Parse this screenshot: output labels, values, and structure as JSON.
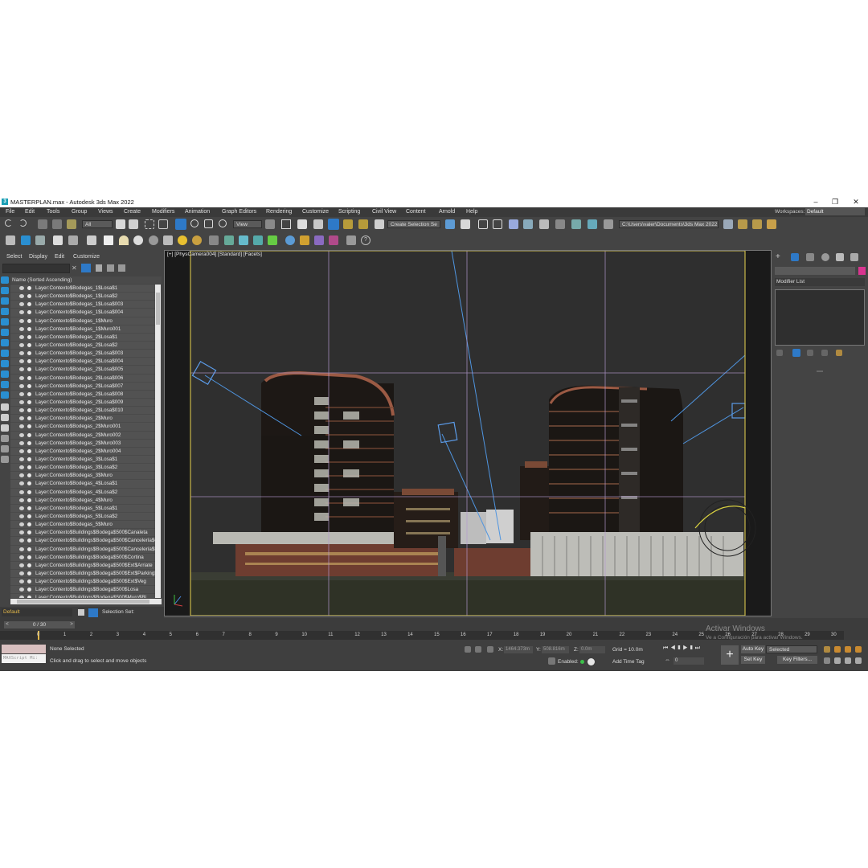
{
  "window": {
    "title": "MASTERPLAN.max - Autodesk 3ds Max 2022",
    "app_icon": "3"
  },
  "menu": [
    "File",
    "Edit",
    "Tools",
    "Group",
    "Views",
    "Create",
    "Modifiers",
    "Animation",
    "Graph Editors",
    "Rendering",
    "Customize",
    "Scripting",
    "Civil View",
    "Content",
    "Arnold",
    "Help"
  ],
  "workspaces": {
    "label": "Workspaces:",
    "value": "Default"
  },
  "toolbar": {
    "filter_value": "All",
    "ref_coord": "View",
    "named_selection_placeholder": "Create Selection Se",
    "project_path": "C:\\Users\\valer\\Documents\\3ds Max 2022"
  },
  "scene_explorer": {
    "tabs": [
      "Select",
      "Display",
      "Edit",
      "Customize"
    ],
    "header": "Name (Sorted Ascending)",
    "items": [
      "Layer:Contexto$Bodegas_1$Losa$1",
      "Layer:Contexto$Bodegas_1$Losa$2",
      "Layer:Contexto$Bodegas_1$Losa$003",
      "Layer:Contexto$Bodegas_1$Losa$004",
      "Layer:Contexto$Bodegas_1$Muro",
      "Layer:Contexto$Bodegas_1$Muro001",
      "Layer:Contexto$Bodegas_2$Losa$1",
      "Layer:Contexto$Bodegas_2$Losa$2",
      "Layer:Contexto$Bodegas_2$Losa$003",
      "Layer:Contexto$Bodegas_2$Losa$004",
      "Layer:Contexto$Bodegas_2$Losa$005",
      "Layer:Contexto$Bodegas_2$Losa$006",
      "Layer:Contexto$Bodegas_2$Losa$007",
      "Layer:Contexto$Bodegas_2$Losa$008",
      "Layer:Contexto$Bodegas_2$Losa$009",
      "Layer:Contexto$Bodegas_2$Losa$010",
      "Layer:Contexto$Bodegas_2$Muro",
      "Layer:Contexto$Bodegas_2$Muro001",
      "Layer:Contexto$Bodegas_2$Muro002",
      "Layer:Contexto$Bodegas_2$Muro003",
      "Layer:Contexto$Bodegas_2$Muro004",
      "Layer:Contexto$Bodegas_3$Losa$1",
      "Layer:Contexto$Bodegas_3$Losa$2",
      "Layer:Contexto$Bodegas_3$Muro",
      "Layer:Contexto$Bodegas_4$Losa$1",
      "Layer:Contexto$Bodegas_4$Losa$2",
      "Layer:Contexto$Bodegas_4$Muro",
      "Layer:Contexto$Bodegas_5$Losa$1",
      "Layer:Contexto$Bodegas_5$Losa$2",
      "Layer:Contexto$Bodegas_5$Muro",
      "Layer:Contexto$Buildings$Bodega$500$Canaleta",
      "Layer:Contexto$Buildings$Bodega$500$Cancelería$Gl",
      "Layer:Contexto$Buildings$Bodega$500$Cancelería$Pe",
      "Layer:Contexto$Buildings$Bodega$500$Cortina",
      "Layer:Contexto$Buildings$Bodega$500$Ext$Arriate",
      "Layer:Contexto$Buildings$Bodega$500$Ext$Parking$T",
      "Layer:Contexto$Buildings$Bodega$500$Ext$Veg",
      "Layer:Contexto$Buildings$Bodega$500$Losa",
      "Layer:Contexto$Buildings$Bodega$500$Muro$Bl"
    ]
  },
  "layer": {
    "current": "Default",
    "selection_set_label": "Selection Set:"
  },
  "viewport": {
    "label": "[+] [PhysCamera004] [Standard] [Facets]"
  },
  "command_panel": {
    "modifier_list": "Modifier List",
    "color": "#d9348f"
  },
  "timeline": {
    "frame_display": "0 / 30",
    "ticks": [
      "0",
      "1",
      "2",
      "3",
      "4",
      "5",
      "6",
      "7",
      "8",
      "9",
      "10",
      "11",
      "12",
      "13",
      "14",
      "15",
      "16",
      "17",
      "18",
      "19",
      "20",
      "21",
      "22",
      "23",
      "24",
      "25",
      "26",
      "27",
      "28",
      "29",
      "30"
    ]
  },
  "status": {
    "maxscript_placeholder": "MAXScript Mi:",
    "selection": "None Selected",
    "prompt": "Click and drag to select and move objects",
    "x_label": "X:",
    "x_value": "1464.373m",
    "y_label": "Y:",
    "y_value": "508.816m",
    "z_label": "Z:",
    "z_value": "0.0m",
    "grid": "Grid = 10.0m",
    "enabled_label": "Enabled:",
    "add_time_tag": "Add Time Tag",
    "auto_key": "Auto Key",
    "set_key": "Set Key",
    "key_mode": "Selected",
    "key_filters": "Key Filters...",
    "current_frame": "0",
    "watermark_title": "Activar Windows",
    "watermark_sub": "Ve a Configuración para activar Windows."
  },
  "icons": [
    "undo-icon",
    "redo-icon",
    "link-icon",
    "unlink-icon",
    "bind-spacewarp-icon",
    "select-object-icon",
    "select-by-name-icon",
    "rect-region-icon",
    "window-crossing-icon",
    "move-icon",
    "rotate-icon",
    "scale-icon",
    "placement-icon",
    "pivot-icon",
    "mirror-icon",
    "align-icon",
    "snap-icon",
    "angle-snap-icon",
    "percent-snap-icon",
    "spinner-snap-icon",
    "layer-explorer-icon",
    "ribbon-icon",
    "curve-editor-icon",
    "schematic-icon",
    "material-editor-icon",
    "render-setup-icon",
    "render-frame-icon",
    "render-icon",
    "play-icon",
    "key-icon"
  ]
}
